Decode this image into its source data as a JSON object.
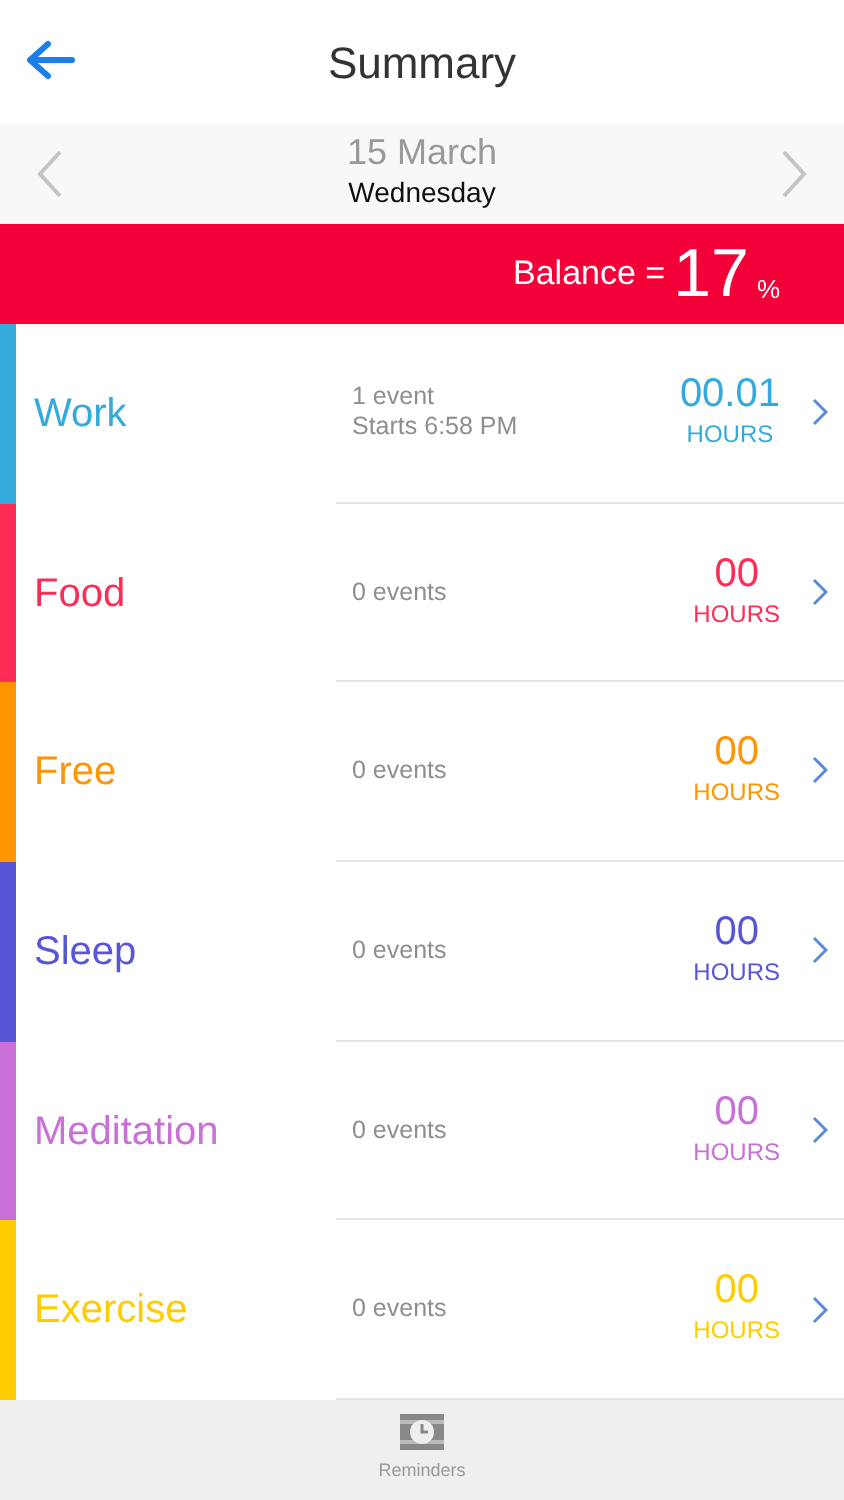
{
  "header": {
    "title": "Summary"
  },
  "date": {
    "day": "15 March",
    "weekday": "Wednesday"
  },
  "balance": {
    "label": "Balance =",
    "value": "17",
    "unit": "%"
  },
  "categories": [
    {
      "name": "Work",
      "color": "#34aadc",
      "events": [
        "1 event",
        "Starts 6:58 PM"
      ],
      "hours": "00.01",
      "unit": "HOURS"
    },
    {
      "name": "Food",
      "color": "#ff2d55",
      "events": [
        "0 events"
      ],
      "hours": "00",
      "unit": "HOURS"
    },
    {
      "name": "Free",
      "color": "#ff9500",
      "events": [
        "0 events"
      ],
      "hours": "00",
      "unit": "HOURS"
    },
    {
      "name": "Sleep",
      "color": "#5856d6",
      "events": [
        "0 events"
      ],
      "hours": "00",
      "unit": "HOURS"
    },
    {
      "name": "Meditation",
      "color": "#c86fd8",
      "events": [
        "0 events"
      ],
      "hours": "00",
      "unit": "HOURS"
    },
    {
      "name": "Exercise",
      "color": "#ffcc00",
      "events": [
        "0 events"
      ],
      "hours": "00",
      "unit": "HOURS"
    }
  ],
  "tab_bar": {
    "label": "Reminders"
  }
}
